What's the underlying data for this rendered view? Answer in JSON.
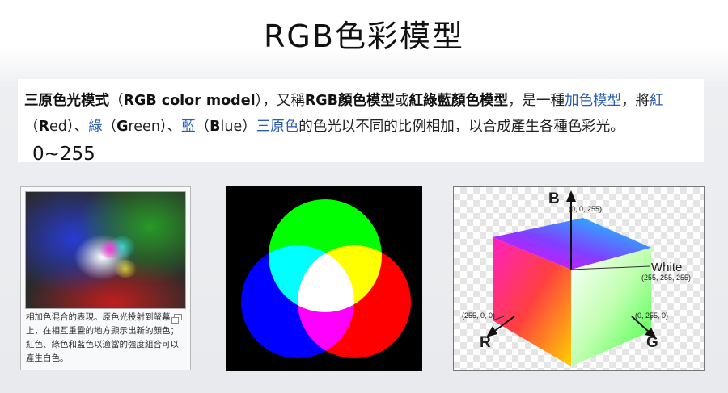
{
  "slide": {
    "title": "RGB色彩模型"
  },
  "wiki": {
    "t1": "三原色光模式",
    "t2": "（",
    "t3": "RGB color model",
    "t4": "），又稱",
    "t5": "RGB顏色模型",
    "t6": "或",
    "t7": "紅綠藍顏色模型",
    "t8": "，是一種",
    "t9": "加色模型",
    "t10": "，將",
    "t11": "紅",
    "t12": "（",
    "t13": "R",
    "t14": "ed）、",
    "t15": "綠",
    "t16": "（",
    "t17": "G",
    "t18": "reen）、",
    "t19": "藍",
    "t20": "（",
    "t21": "B",
    "t22": "lue）",
    "t23": "三原色",
    "t24": "的色光以不同的比例相加，以合成產生各種色彩光。",
    "range": "0~255"
  },
  "panel1": {
    "caption": "相加色混合的表現。原色光投射到螢幕上，在相互重疊的地方顯示出新的顏色；紅色、綠色和藍色以適當的強度組合可以產生白色。"
  },
  "cube": {
    "b_label": "B",
    "b_coord": "(0, 0, 255)",
    "white_label": "White",
    "white_coord": "(255, 255, 255)",
    "r_coord": "(255, 0, 0)",
    "r_label": "R",
    "g_coord": "(0, 255, 0)",
    "g_label": "G"
  },
  "colors": {
    "link": "#2a5db0",
    "red": "#ff0000",
    "green": "#00ff00",
    "blue": "#0000ff"
  }
}
